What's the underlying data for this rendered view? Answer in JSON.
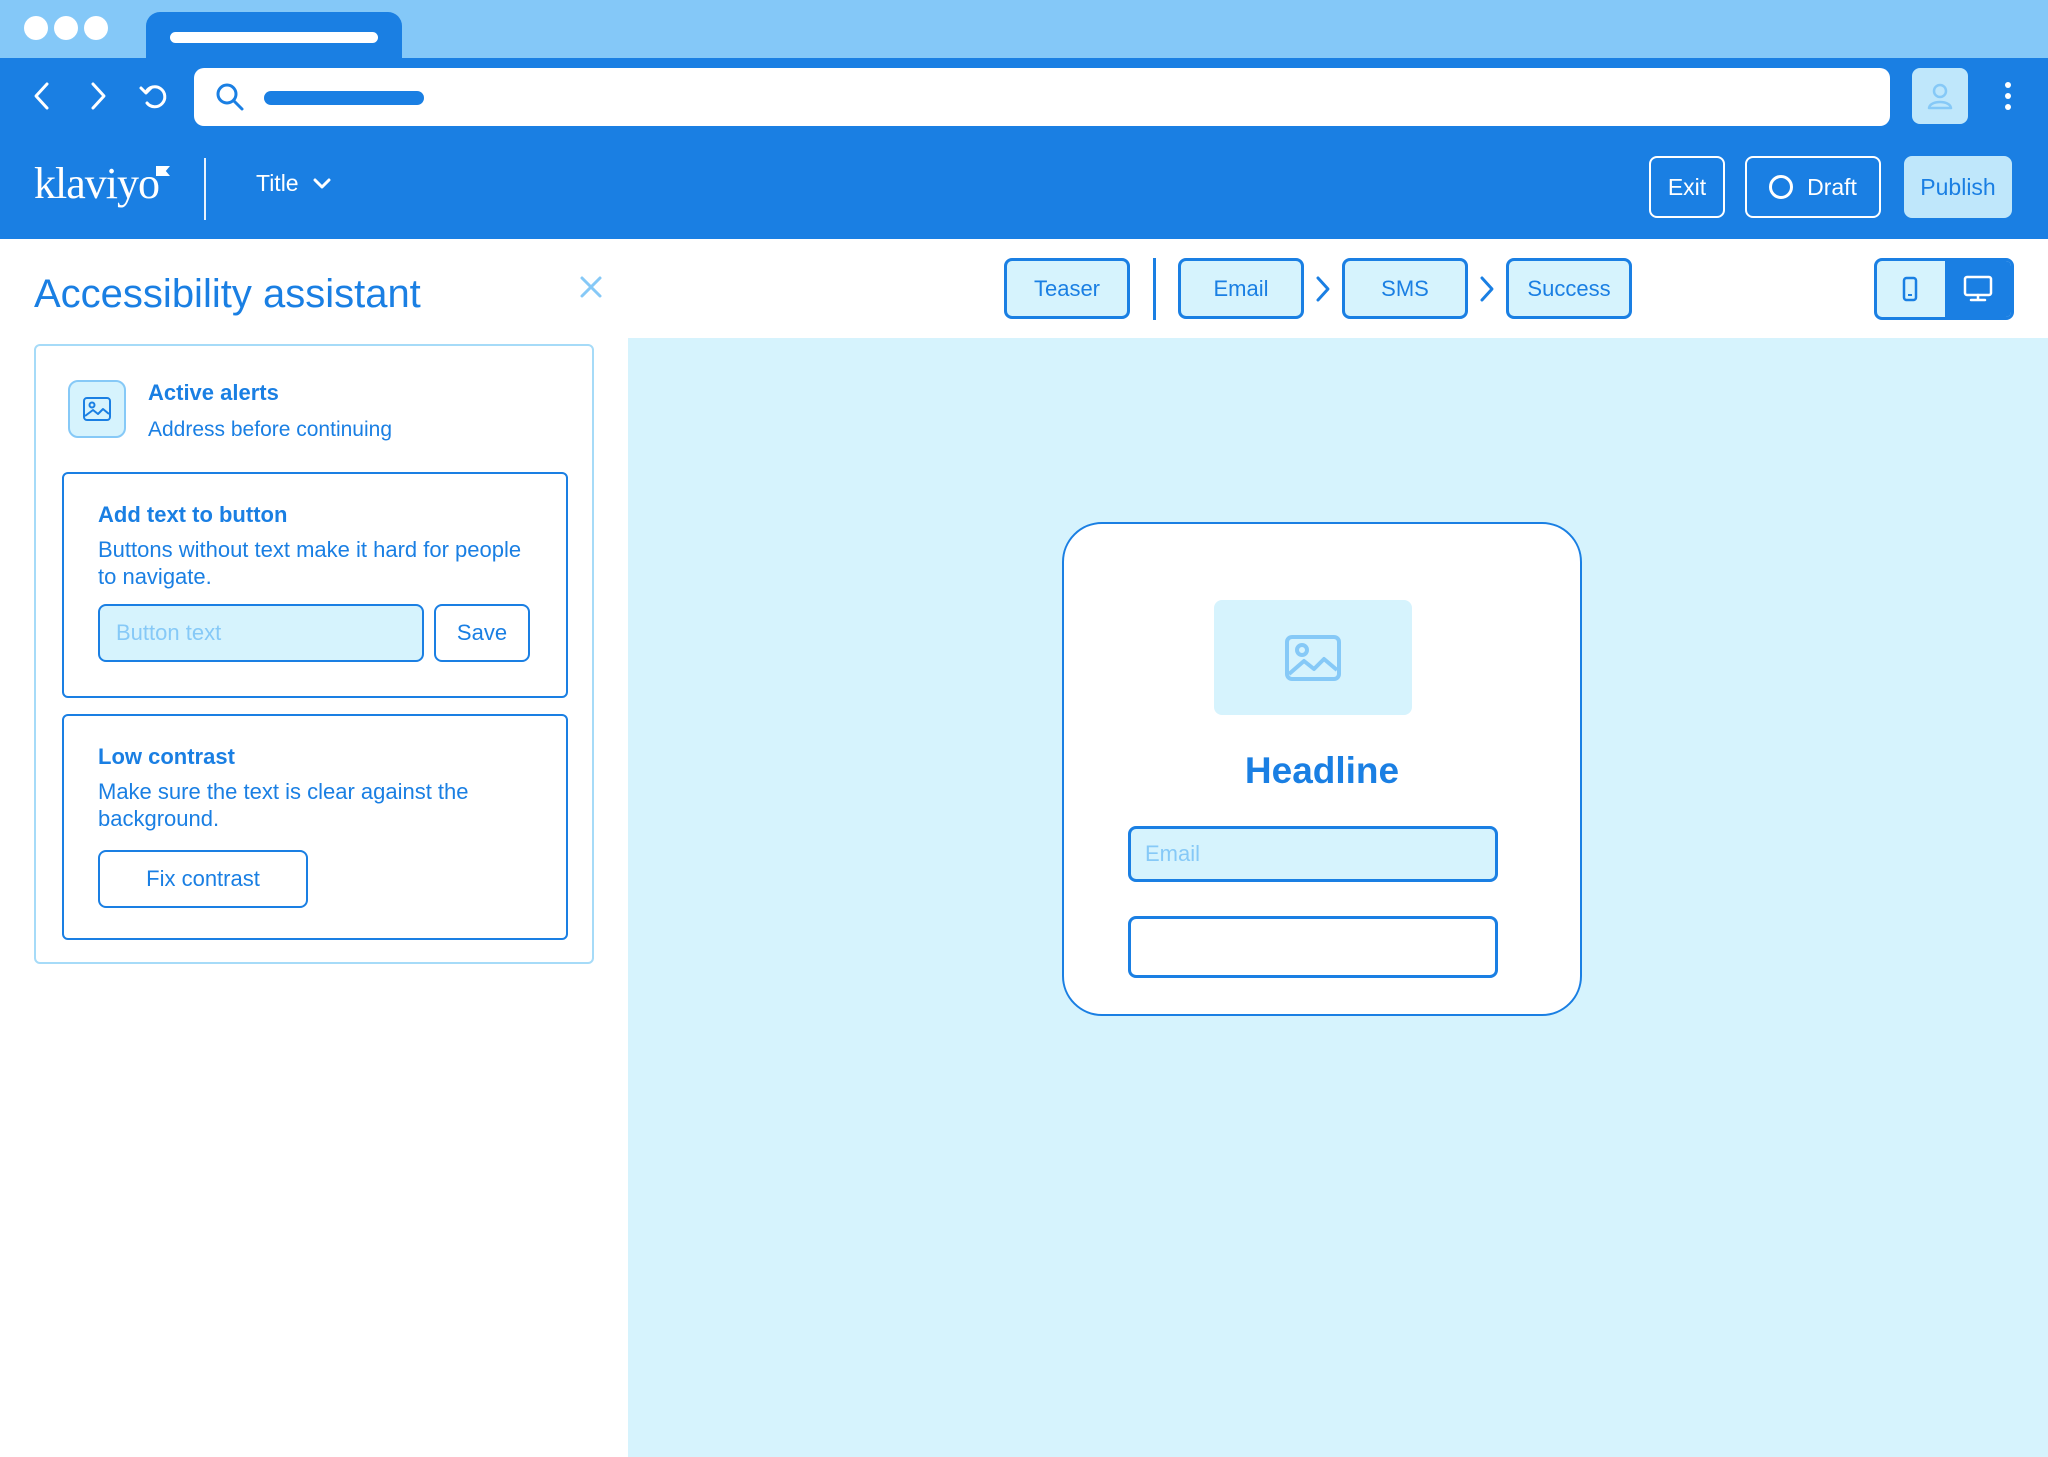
{
  "browser": {
    "tab_title": "",
    "address": "",
    "icons": [
      "back-arrow-icon",
      "forward-arrow-icon",
      "reload-icon",
      "search-icon",
      "user-icon",
      "more-vertical-icon"
    ]
  },
  "header": {
    "logo": "klaviyo",
    "title_dropdown": "Title",
    "exit_label": "Exit",
    "draft_label": "Draft",
    "publish_label": "Publish"
  },
  "steps": {
    "teaser": "Teaser",
    "email": "Email",
    "sms": "SMS",
    "success": "Success"
  },
  "device_toggle": {
    "options": [
      "mobile",
      "desktop"
    ],
    "selected": "desktop"
  },
  "assistant": {
    "title": "Accessibility assistant",
    "active_alerts_title": "Active alerts",
    "active_alerts_subtitle": "Address before continuing",
    "issues": [
      {
        "title": "Add text to button",
        "description": "Buttons without text make it hard for people to navigate.",
        "input_placeholder": "Button text",
        "action_label": "Save"
      },
      {
        "title": "Low contrast",
        "description": "Make sure the text is clear against the background.",
        "action_label": "Fix contrast"
      }
    ]
  },
  "preview": {
    "headline": "Headline",
    "email_placeholder": "Email",
    "submit_label": ""
  },
  "colors": {
    "primary": "#1a7fe3",
    "chrome_light": "#84c8f8",
    "canvas_bg": "#d6f3fd",
    "accent_light": "#bfe7fb",
    "border_light": "#a6dbf8"
  }
}
